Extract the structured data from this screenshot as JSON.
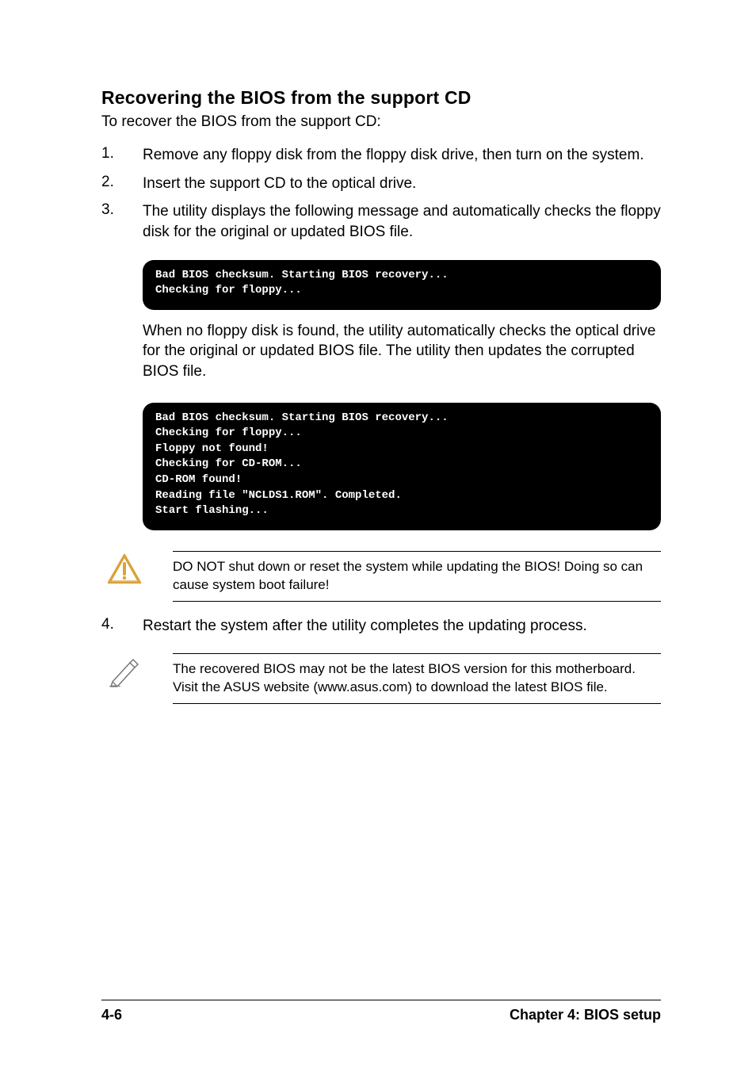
{
  "title": "Recovering the BIOS from the support CD",
  "intro": "To recover the BIOS from the support CD:",
  "steps": {
    "s1": {
      "num": "1.",
      "text": "Remove any floppy disk from the floppy disk drive, then turn on the system."
    },
    "s2": {
      "num": "2.",
      "text": "Insert the support CD to the optical drive."
    },
    "s3": {
      "num": "3.",
      "text": "The utility displays the following message and automatically checks the floppy disk for the original or updated BIOS file."
    },
    "s4": {
      "num": "4.",
      "text": "Restart the system after the utility completes the updating process."
    }
  },
  "terminal1": "Bad BIOS checksum. Starting BIOS recovery...\nChecking for floppy...",
  "midtext": "When no floppy disk is found, the utility automatically checks the optical drive for the original or updated BIOS file. The utility then updates the corrupted BIOS file.",
  "terminal2": "Bad BIOS checksum. Starting BIOS recovery...\nChecking for floppy...\nFloppy not found!\nChecking for CD-ROM...\nCD-ROM found!\nReading file \"NCLDS1.ROM\". Completed.\nStart flashing...",
  "warning": "DO NOT shut down or reset the system while updating the BIOS! Doing so can cause system boot failure!",
  "note": "The recovered BIOS may not be the latest BIOS version for this motherboard. Visit the ASUS website (www.asus.com) to download the latest BIOS file.",
  "footer": {
    "left": "4-6",
    "right": "Chapter 4: BIOS setup"
  }
}
